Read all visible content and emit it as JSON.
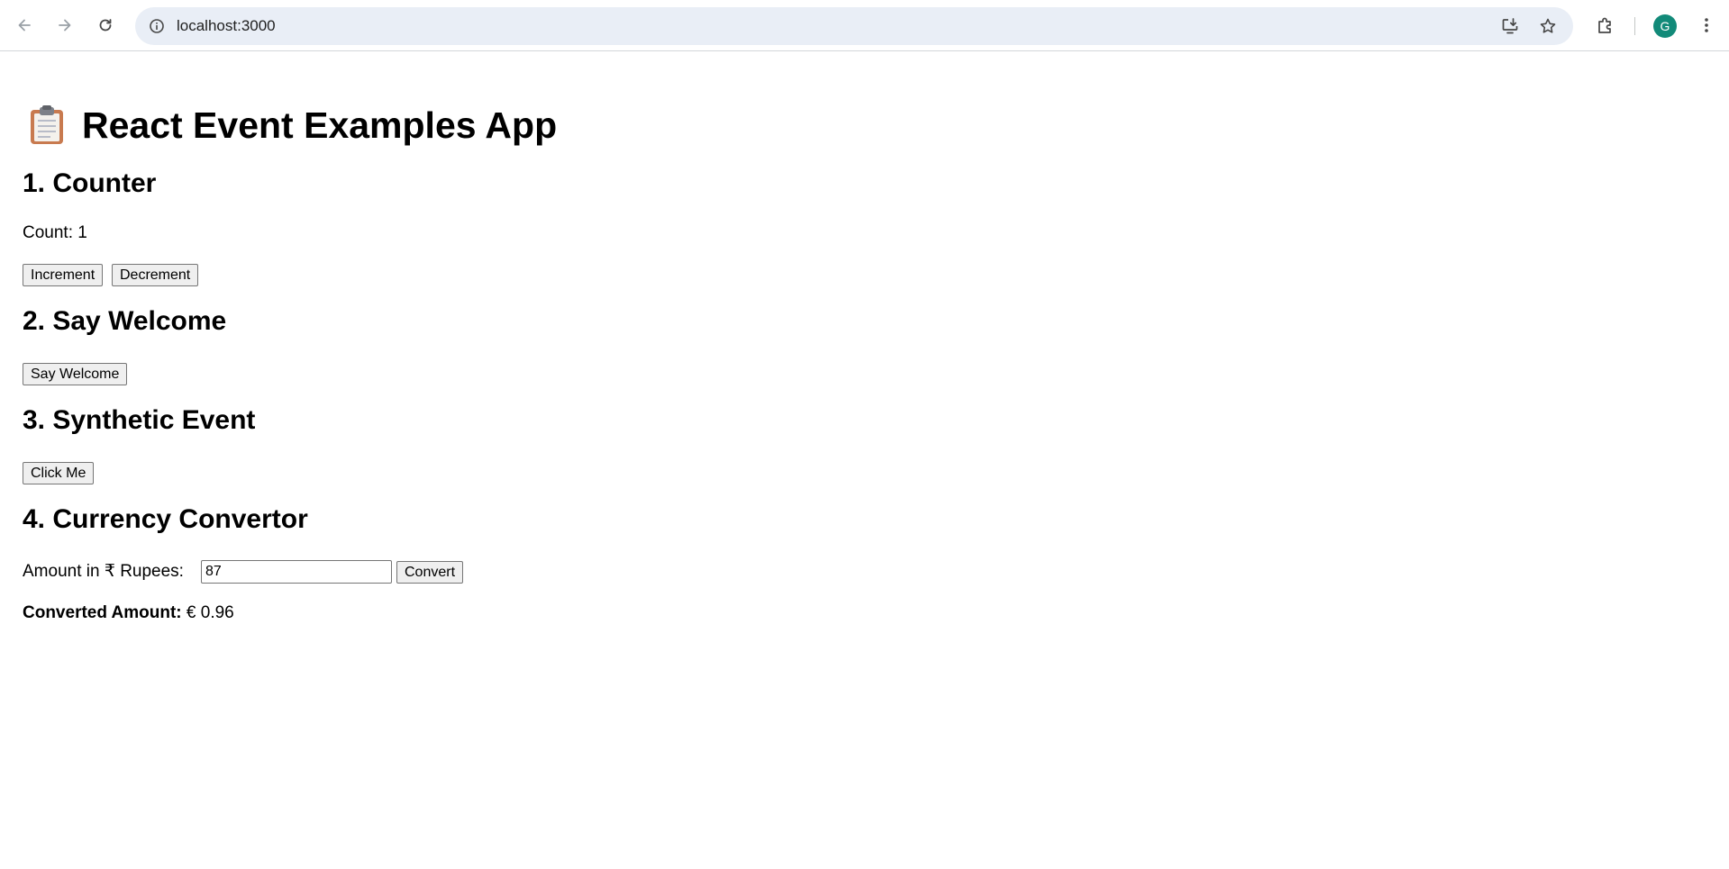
{
  "browser": {
    "url": "localhost:3000",
    "profile_initial": "G",
    "profile_color": "#128a79",
    "icons": {
      "back": "arrow-left-icon",
      "forward": "arrow-right-icon",
      "reload": "reload-icon",
      "site_info": "info-circle-icon",
      "install": "install-app-icon",
      "bookmark": "star-icon",
      "extensions": "puzzle-icon",
      "menu": "kebab-menu-icon"
    }
  },
  "app": {
    "title": "React Event Examples App",
    "title_icon": "clipboard-emoji-icon"
  },
  "counter": {
    "heading": "1. Counter",
    "count_label": "Count: 1",
    "increment_label": "Increment",
    "decrement_label": "Decrement"
  },
  "welcome": {
    "heading": "2. Say Welcome",
    "button_label": "Say Welcome"
  },
  "synthetic": {
    "heading": "3. Synthetic Event",
    "button_label": "Click Me"
  },
  "currency": {
    "heading": "4. Currency Convertor",
    "amount_label": "Amount in ₹ Rupees:",
    "amount_value": "87",
    "convert_label": "Convert",
    "result_label": "Converted Amount:",
    "result_value": "€ 0.96"
  }
}
